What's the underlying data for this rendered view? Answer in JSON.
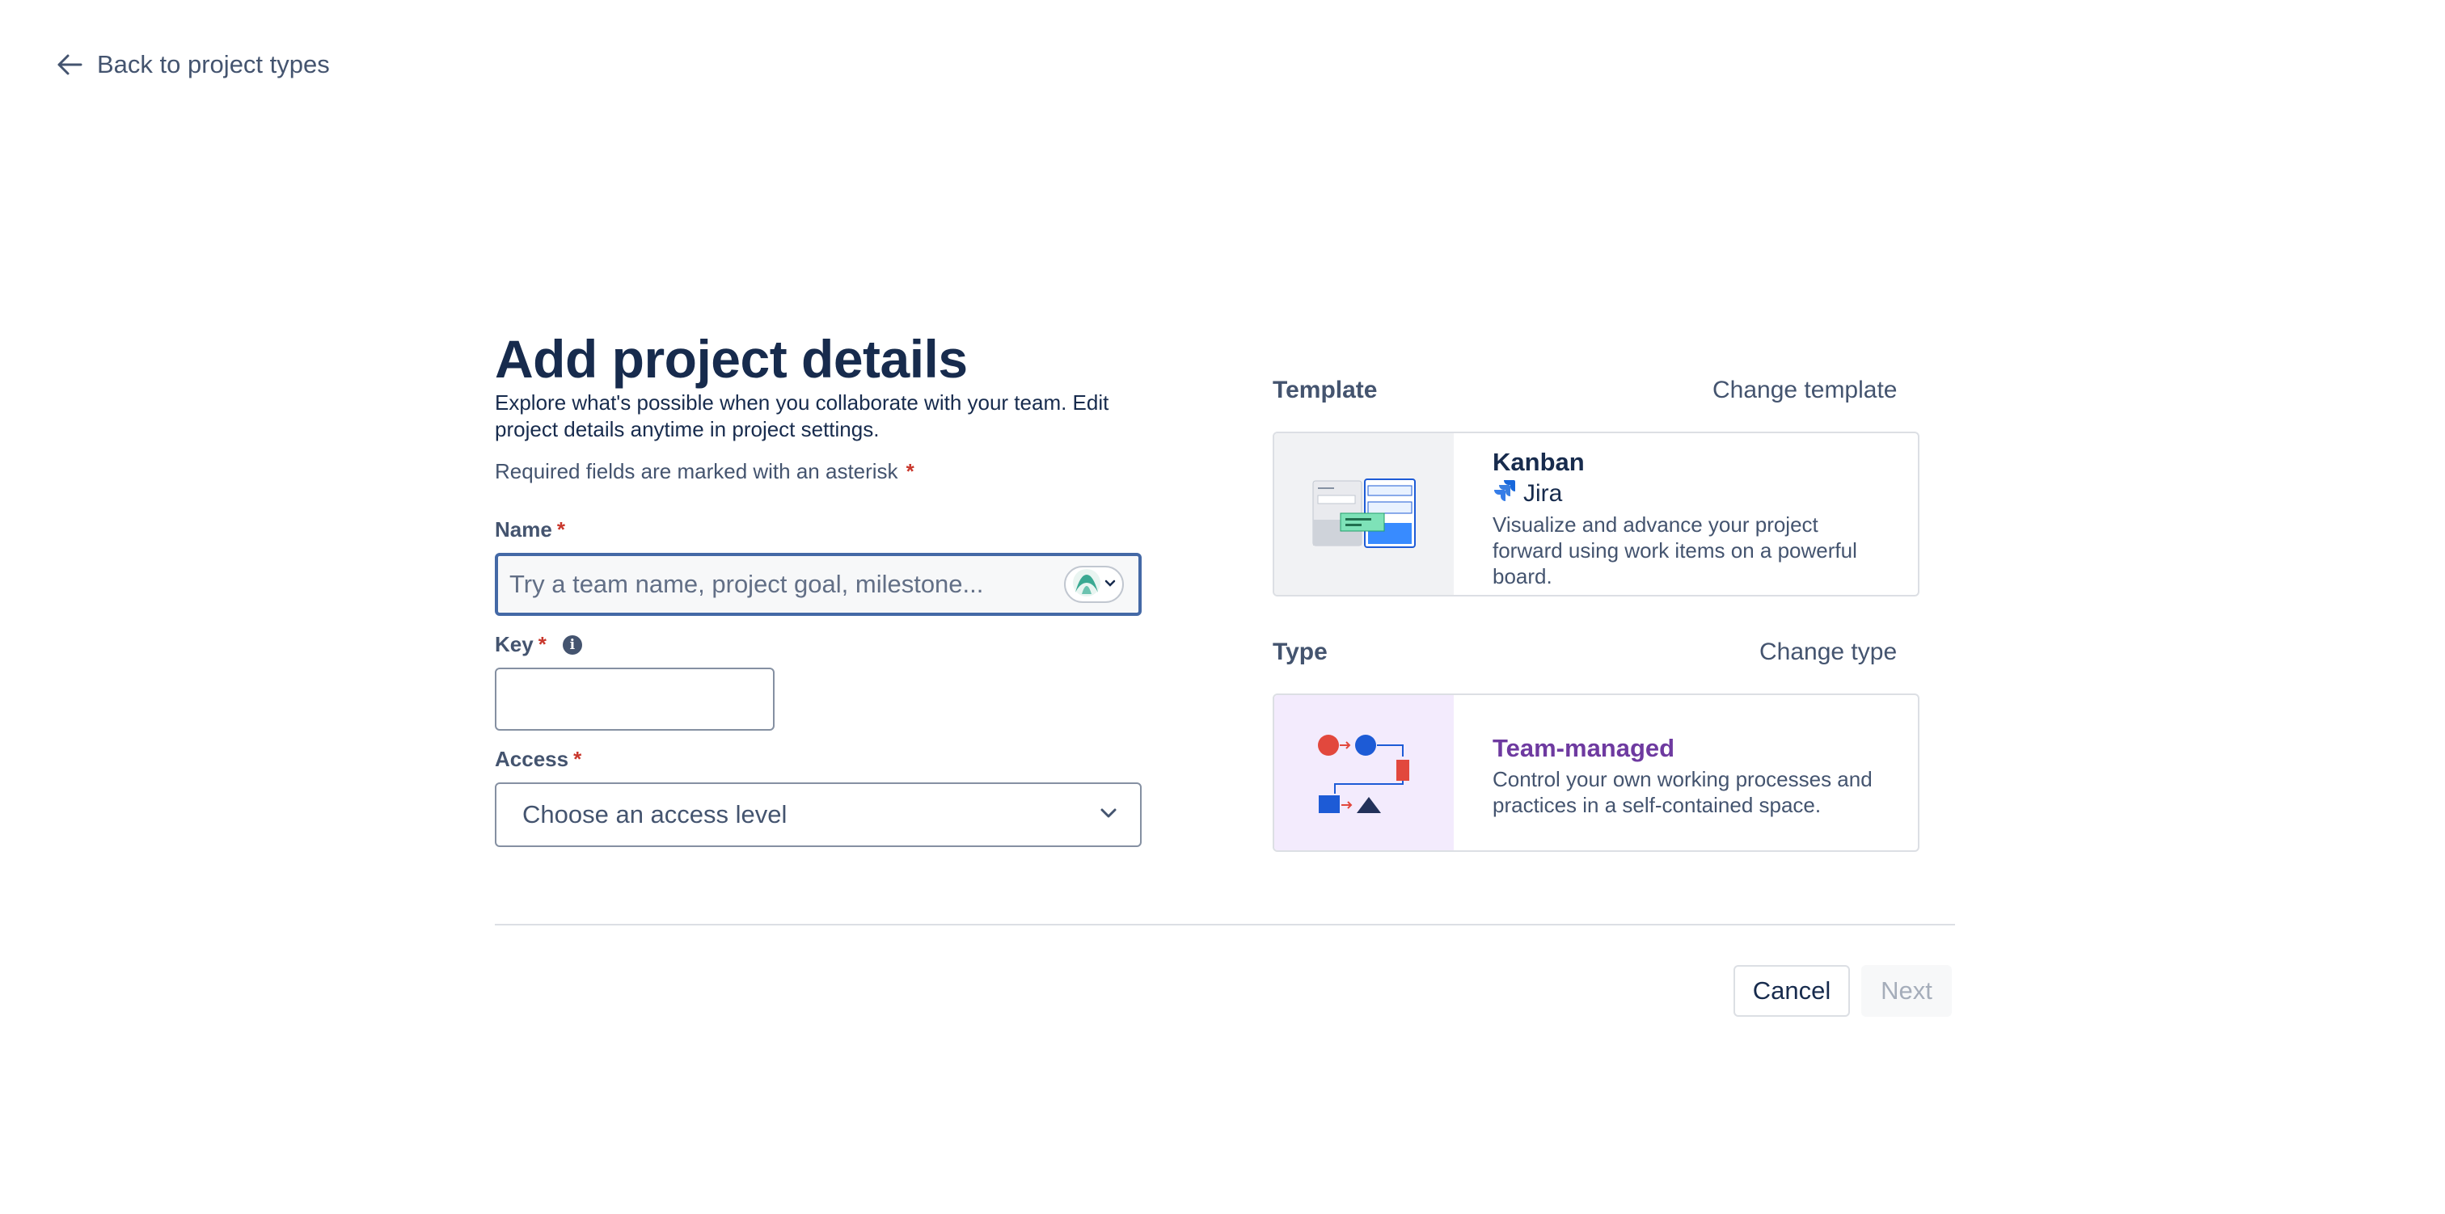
{
  "nav": {
    "back_label": "Back to project types"
  },
  "header": {
    "title": "Add project details",
    "description": "Explore what's possible when you collaborate with your team. Edit project details anytime in project settings.",
    "required_note": "Required fields are marked with an asterisk",
    "asterisk": "*"
  },
  "form": {
    "name": {
      "label": "Name",
      "placeholder": "Try a team name, project goal, milestone..."
    },
    "key": {
      "label": "Key",
      "value": ""
    },
    "access": {
      "label": "Access",
      "placeholder": "Choose an access level"
    }
  },
  "template": {
    "section_title": "Template",
    "change_label": "Change template",
    "name": "Kanban",
    "product": "Jira",
    "description": "Visualize and advance your project forward using work items on a powerful board."
  },
  "type": {
    "section_title": "Type",
    "change_label": "Change type",
    "name": "Team-managed",
    "description": "Control your own working processes and practices in a self-contained space."
  },
  "actions": {
    "cancel_label": "Cancel",
    "next_label": "Next"
  },
  "icons": {
    "back": "arrow-left-icon",
    "info": "info-icon",
    "chevron": "chevron-down-icon",
    "project_avatar": "project-avatar-icon",
    "jira": "jira-logo-icon"
  },
  "colors": {
    "focus_border": "#4469a6",
    "required": "#c9372c",
    "team_managed": "#6e3aa0",
    "text": "#172b4d",
    "subtle_text": "#44546f"
  }
}
